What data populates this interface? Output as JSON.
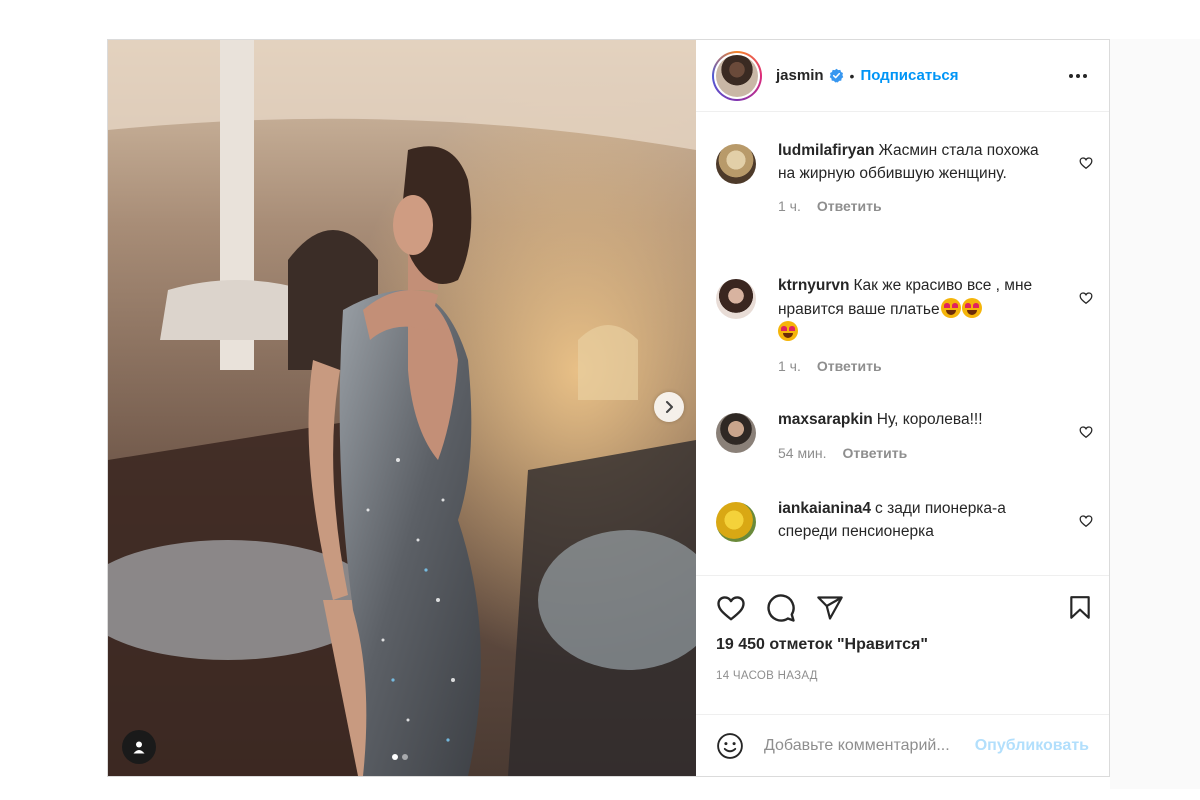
{
  "post": {
    "author": {
      "username": "jasmin",
      "verified": true,
      "follow_label": "Подписаться",
      "separator": "•"
    },
    "media": {
      "description_icons": [
        "chevron-right-icon",
        "person-tag-icon"
      ],
      "carousel_count": 2,
      "carousel_active": 0
    },
    "comments": [
      {
        "username": "ludmilafiryan",
        "text": "Жасмин стала похожа на жирную оббившую женщину.",
        "time": "1 ч.",
        "reply_label": "Ответить",
        "avatar_color": "#b89a6a"
      },
      {
        "username": "ktrnyurvn",
        "text": "Как же красиво все , мне нравится ваше платье",
        "emojis": 3,
        "time": "1 ч.",
        "reply_label": "Ответить",
        "avatar_color": "#8a6a5c"
      },
      {
        "username": "maxsarapkin",
        "text": "Ну, королева!!!",
        "time": "54 мин.",
        "reply_label": "Ответить",
        "avatar_color": "#5a5248"
      },
      {
        "username": "iankaianina4",
        "text": "с зади пионерка-а спереди пенсионерка",
        "time": "",
        "reply_label": "",
        "avatar_color": "#d9b419"
      }
    ],
    "likes_text": "19 450 отметок \"Нравится\"",
    "time_ago": "14 часов назад",
    "comment_input": {
      "placeholder": "Добавьте комментарий...",
      "publish_label": "Опубликовать"
    },
    "colors": {
      "accent": "#0095f6",
      "publish_disabled": "#b2dffc",
      "muted": "#8e8e8e"
    }
  }
}
